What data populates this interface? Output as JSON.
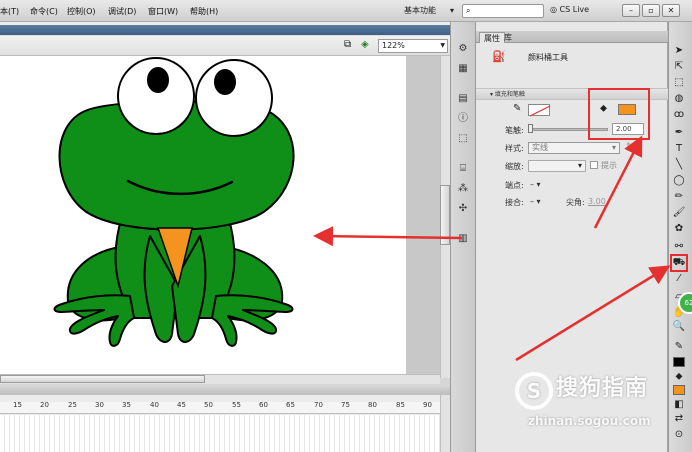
{
  "menubar": {
    "items": [
      "本(T)",
      "命令(C)",
      "控制(O)",
      "调试(D)",
      "窗口(W)",
      "帮助(H)"
    ],
    "workspace": "基本功能",
    "search_placeholder": "",
    "cs_live": "CS Live",
    "window_buttons": [
      "–",
      "▫",
      "✕"
    ]
  },
  "stage": {
    "zoom": "122%"
  },
  "timeline": {
    "ruler_ticks": [
      "15",
      "20",
      "25",
      "30",
      "35",
      "40",
      "45",
      "50",
      "55",
      "60",
      "65",
      "70",
      "75",
      "80",
      "85",
      "90"
    ]
  },
  "properties": {
    "tabs": [
      "属性",
      "库"
    ],
    "tool_title": "颜料桶工具",
    "section_title": "填充和笔触",
    "stroke_label": "笔触:",
    "stroke_value": "2.00",
    "style_label": "样式:",
    "style_value": "实线",
    "scale_label": "缩放:",
    "hint_label": "提示",
    "cap_label": "端点:",
    "cap_value": "–",
    "join_label": "接合:",
    "join_value": "–",
    "miter_label": "尖角:",
    "miter_value": "3.00"
  },
  "colors": {
    "frog_body": "#0f8f17",
    "frog_belly": "#f4931e",
    "fill_swatch": "#f4931e",
    "annotation": "#e53030"
  },
  "watermark": {
    "logo": "S",
    "title": "搜狗指南",
    "url": "zhinan.sogou.com"
  },
  "badge": "62"
}
